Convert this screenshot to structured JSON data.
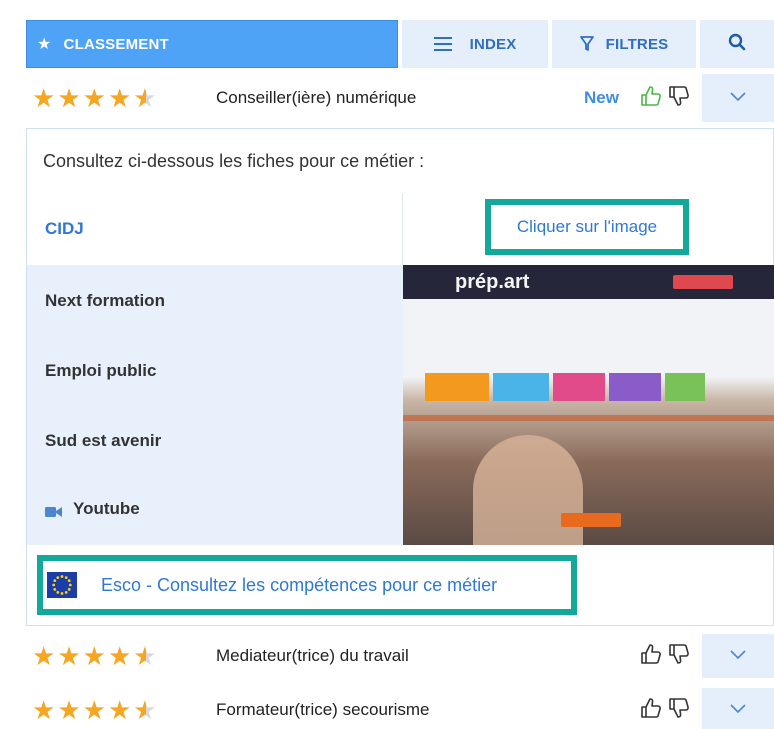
{
  "tabs": {
    "classement": {
      "label": "CLASSEMENT",
      "icon": "star-icon"
    },
    "index": {
      "label": "INDEX",
      "icon": "menu-icon"
    },
    "filtres": {
      "label": "FILTRES",
      "icon": "filter-icon"
    },
    "search": {
      "icon": "search-icon"
    }
  },
  "jobs": [
    {
      "title": "Conseiller(ière) numérique",
      "rating": 4.5,
      "badge": "New",
      "expanded": true
    },
    {
      "title": "Mediateur(trice) du travail",
      "rating": 4.5,
      "badge": "",
      "expanded": false
    },
    {
      "title": "Formateur(trice) secourisme",
      "rating": 4.5,
      "badge": "",
      "expanded": false
    }
  ],
  "panel": {
    "intro": "Consultez ci-dessous les fiches pour ce métier :",
    "sources": [
      {
        "label": "CIDJ"
      },
      {
        "label": "Next formation"
      },
      {
        "label": "Emploi public"
      },
      {
        "label": "Sud est avenir"
      },
      {
        "label": "Youtube",
        "icon": "video-camera-icon"
      }
    ],
    "click_label": "Cliquer sur l'image",
    "preview_logo": "prép.art",
    "esco_label": "Esco - Consultez les compétences pour ce métier"
  },
  "colors": {
    "accent": "#4fa3f7",
    "tab_bg": "#e4effb",
    "link": "#2f78d6",
    "highlight_border": "#14a89a",
    "star": "#f5a623"
  }
}
